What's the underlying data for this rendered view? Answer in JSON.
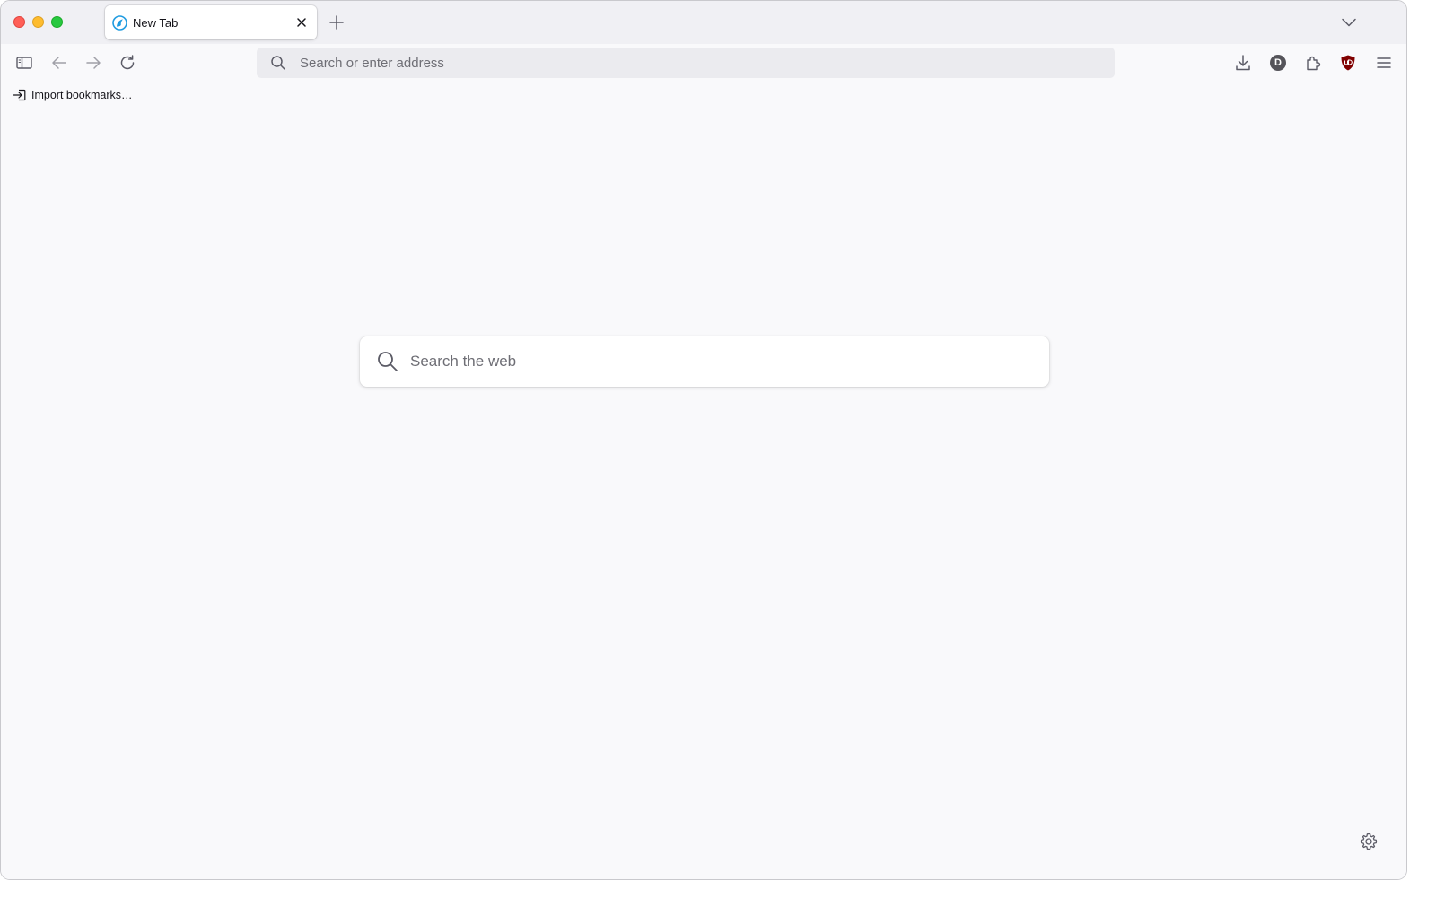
{
  "browser": {
    "tabs": [
      {
        "title": "New Tab",
        "favicon": "firefox-icon",
        "active": true
      }
    ]
  },
  "toolbar": {
    "icons": [
      "sidebar-icon",
      "back-icon",
      "forward-icon",
      "reload-icon",
      "downloads-icon",
      "account-icon",
      "extensions-icon",
      "ublock-icon",
      "menu-icon"
    ],
    "account_initial": "D"
  },
  "urlbar": {
    "value": "",
    "placeholder": "Search or enter address"
  },
  "bookmarks": {
    "items": [
      {
        "label": "Import bookmarks…",
        "icon": "import-icon"
      }
    ]
  },
  "newtab": {
    "search": {
      "value": "",
      "placeholder": "Search the web"
    }
  },
  "colors": {
    "window_bg": "#f9f9fb",
    "tabstrip_bg": "#f0f0f4",
    "urlbar_bg": "#ebebef",
    "ublock_red": "#800000",
    "firefox_blue": "#1f9be0"
  }
}
